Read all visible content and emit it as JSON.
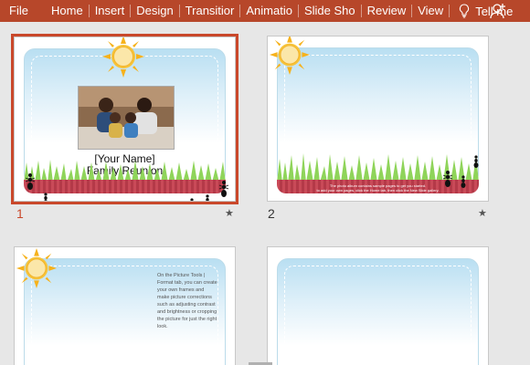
{
  "ribbon": {
    "tabs": [
      "File",
      "Home",
      "Insert",
      "Design",
      "Transitior",
      "Animatio",
      "Slide Sho",
      "Review",
      "View"
    ],
    "tell_me": "Tell me",
    "bg_color": "#b7472a"
  },
  "slides": [
    {
      "number": "1",
      "selected": true,
      "caption_line1": "[Your Name]",
      "caption_line2": "Family Reunion",
      "star": "★"
    },
    {
      "number": "2",
      "selected": false,
      "band_text_line1": "The photo album contains sample pages to get you started.",
      "band_text_line2": "to add your own pages, click the Home tab, then click the New Slide gallery.",
      "star": "★"
    },
    {
      "number": "",
      "selected": false,
      "body_text": "On the Picture Tools | Format tab, you can create your own frames and make picture corrections such as adjusting contrast and brightness or cropping the picture for just the right look."
    },
    {
      "number": "",
      "selected": false
    }
  ],
  "accent_color": "#c9482b",
  "icons": [
    "lightbulb-icon",
    "share-user-icon",
    "sun-icon",
    "ant-icon",
    "grass-icon",
    "star-icon"
  ]
}
